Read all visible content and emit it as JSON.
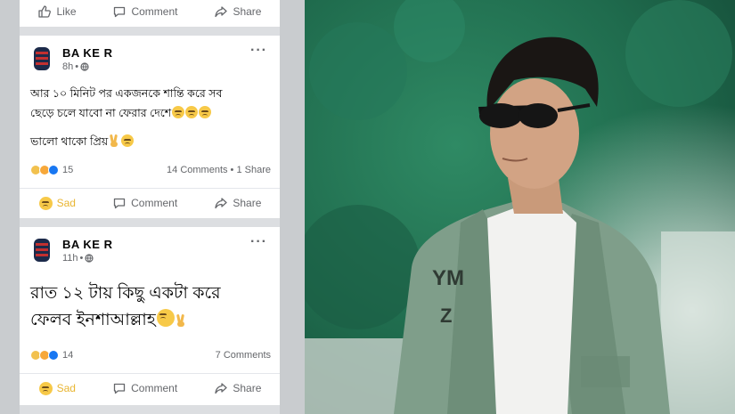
{
  "top_actions": {
    "like": "Like",
    "comment": "Comment",
    "share": "Share"
  },
  "posts": [
    {
      "author": "BA KE R",
      "time": "8h",
      "lines": [
        "আর ১০ মিনিট পর একজনকে শান্তি করে সব",
        "ছেড়ে চলে যাবো না ফেরার দেশে",
        "ভালো থাকো প্রিয়"
      ],
      "reactions_count": "15",
      "stats_right": "14 Comments • 1 Share",
      "actions": {
        "react": "Sad",
        "comment": "Comment",
        "share": "Share"
      }
    },
    {
      "author": "BA KE R",
      "time": "11h",
      "lines": [
        "রাত ১২ টায় কিছু একটা করে",
        "ফেলব ইনশাআল্লাহ"
      ],
      "reactions_count": "14",
      "stats_right": "7 Comments",
      "actions": {
        "react": "Sad",
        "comment": "Comment",
        "share": "Share"
      }
    }
  ],
  "photo_shirt_text": [
    "YM",
    "Z"
  ],
  "colors": {
    "sad": "#e9b531",
    "meta": "#65676b",
    "background_green": "#1f6b4d"
  }
}
